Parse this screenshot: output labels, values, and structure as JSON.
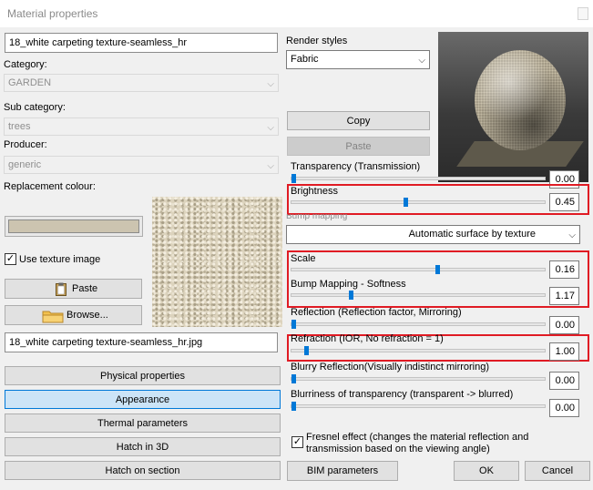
{
  "window": {
    "title": "Material properties"
  },
  "left": {
    "material_name": "18_white carpeting texture-seamless_hr",
    "category_label": "Category:",
    "category_value": "GARDEN",
    "subcategory_label": "Sub category:",
    "subcategory_value": "trees",
    "producer_label": "Producer:",
    "producer_value": "generic",
    "replacement_label": "Replacement colour:",
    "replacement_color": "#ccc4b0",
    "use_texture_label": "Use texture image",
    "use_texture_checked": "✓",
    "paste_label": "Paste",
    "browse_label": "Browse...",
    "texture_file": "18_white carpeting texture-seamless_hr.jpg"
  },
  "nav": {
    "physical": "Physical properties",
    "appearance": "Appearance",
    "thermal": "Thermal parameters",
    "hatch3d": "Hatch in 3D",
    "hatch_section": "Hatch on section"
  },
  "render": {
    "styles_label": "Render styles",
    "style_value": "Fabric",
    "copy_label": "Copy",
    "paste_label": "Paste"
  },
  "params": {
    "transparency_label": "Transparency (Transmission)",
    "transparency_value": "0.00",
    "transparency_level": 0.0,
    "brightness_label": "Brightness",
    "brightness_value": "0.45",
    "brightness_level": 0.45,
    "bump_section_label": "Bump mapping",
    "bump_mode": "Automatic surface by texture",
    "scale_label": "Scale",
    "scale_value": "0.16",
    "scale_level": 0.58,
    "softness_label": "Bump Mapping - Softness",
    "softness_value": "1.17",
    "softness_level": 0.23,
    "reflection_label": "Reflection (Reflection factor, Mirroring)",
    "reflection_value": "0.00",
    "reflection_level": 0.0,
    "refraction_label": "Refraction (IOR, No refraction = 1)",
    "refraction_value": "1.00",
    "refraction_level": 0.05,
    "blurry_label": "Blurry Reflection(Visually indistinct mirroring)",
    "blurry_value": "0.00",
    "blurry_level": 0.0,
    "blurriness_label": "Blurriness of transparency (transparent -> blurred)",
    "blurriness_value": "0.00",
    "blurriness_level": 0.0,
    "fresnel_label_1": "Fresnel effect (changes the material reflection and",
    "fresnel_label_2": "transmission based on the viewing angle)",
    "fresnel_checked": "✓"
  },
  "footer": {
    "bim_label": "BIM parameters",
    "ok_label": "OK",
    "cancel_label": "Cancel"
  },
  "icons": {
    "paste": "clipboard-icon",
    "browse": "folder-icon",
    "close": "close-icon"
  },
  "colors": {
    "highlight": "#e01b24",
    "selected_tab": "#cce4f7",
    "slider": "#0078d7"
  }
}
